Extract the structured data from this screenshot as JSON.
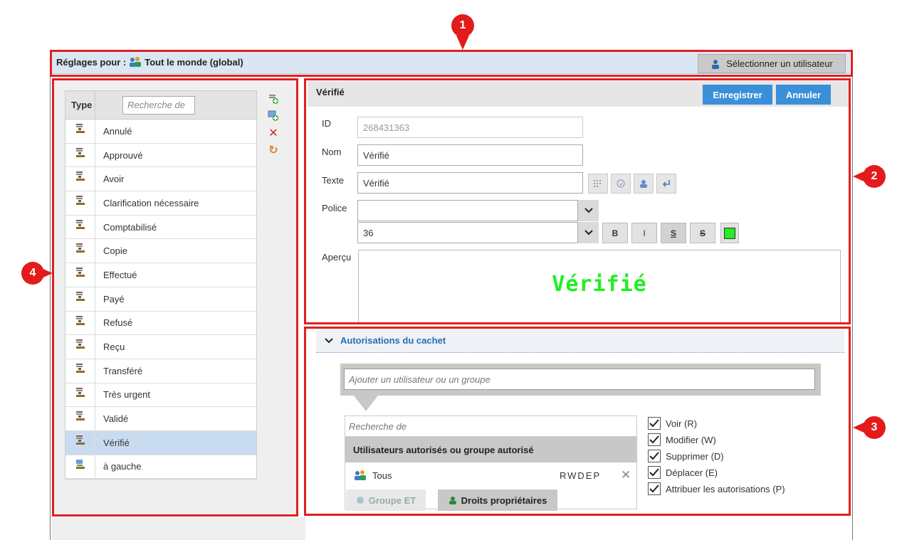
{
  "header": {
    "settings_for_label": "Réglages pour :",
    "scope": "Tout le monde (global)",
    "select_user_label": "Sélectionner un utilisateur"
  },
  "type_list": {
    "col_type": "Type",
    "search_placeholder": "Recherche de",
    "items": [
      {
        "label": "Annulé"
      },
      {
        "label": "Approuvé"
      },
      {
        "label": "Avoir"
      },
      {
        "label": "Clarification nécessaire"
      },
      {
        "label": "Comptabilisé"
      },
      {
        "label": "Copie"
      },
      {
        "label": "Effectué"
      },
      {
        "label": "Payé"
      },
      {
        "label": "Refusé"
      },
      {
        "label": "Reçu"
      },
      {
        "label": "Transféré"
      },
      {
        "label": "Très urgent"
      },
      {
        "label": "Validé"
      },
      {
        "label": "Vérifié",
        "selected": true
      },
      {
        "label": "à gauche"
      }
    ],
    "tools": [
      "add-stamp-icon",
      "add-image-stamp-icon",
      "delete-icon",
      "reset-icon"
    ]
  },
  "form": {
    "title": "Vérifié",
    "save_label": "Enregistrer",
    "cancel_label": "Annuler",
    "id_label": "ID",
    "id_value": "268431363",
    "name_label": "Nom",
    "name_value": "Vérifié",
    "text_label": "Texte",
    "text_value": "Vérifié",
    "font_label": "Police",
    "font_value": "",
    "size_value": "36",
    "fmt_bold": "B",
    "fmt_italic": "I",
    "fmt_underline": "S",
    "fmt_strike": "S",
    "color": "#22ee22",
    "preview_label": "Aperçu",
    "preview_text": "Vérifié"
  },
  "permissions": {
    "section_title": "Autorisations du cachet",
    "add_placeholder": "Ajouter un utilisateur ou un groupe",
    "search_placeholder": "Recherche de",
    "list_header": "Utilisateurs autorisés ou groupe autorisé",
    "rows": [
      {
        "name": "Tous",
        "rights": "RWDEP"
      }
    ],
    "tab_group": "Groupe ET",
    "tab_owner": "Droits propriétaires",
    "checkboxes": [
      {
        "label": "Voir (R)",
        "checked": true
      },
      {
        "label": "Modifier (W)",
        "checked": true
      },
      {
        "label": "Supprimer (D)",
        "checked": true
      },
      {
        "label": "Déplacer (E)",
        "checked": true
      },
      {
        "label": "Attribuer les autorisations (P)",
        "checked": true
      }
    ]
  },
  "callouts": [
    "1",
    "2",
    "3",
    "4"
  ]
}
